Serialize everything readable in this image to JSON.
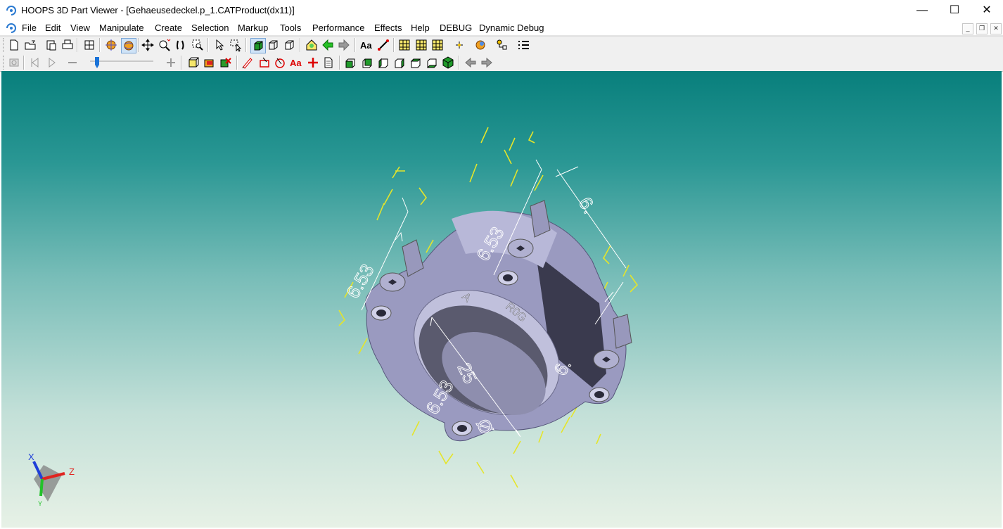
{
  "window": {
    "title": "HOOPS 3D Part Viewer - [Gehaeusedeckel.p_1.CATProduct(dx11)]",
    "controls": {
      "minimize": "—",
      "maximize": "☐",
      "close": "✕"
    }
  },
  "menu": [
    "File",
    "Edit",
    "View",
    "Manipulate",
    "Create",
    "Selection",
    "Markup",
    "Tools",
    "Performance",
    "Effects",
    "Help",
    "DEBUG",
    "Dynamic Debug"
  ],
  "mdi_controls": {
    "minimize": "_",
    "restore": "❐",
    "close": "✕"
  },
  "toolbar1_icons": [
    "new-file-icon",
    "open-file-icon",
    "paste-icon",
    "print-icon",
    "grid-icon",
    "orbit-icon",
    "turntable-icon",
    "pan-icon",
    "zoom-icon",
    "walk-icon",
    "zoom-window-icon",
    "select-icon",
    "select-area-icon",
    "shaded-icon",
    "wireframe-icon",
    "hidden-line-icon",
    "home-icon",
    "back-icon",
    "forward-icon",
    "text-icon",
    "measure-icon",
    "section-icon",
    "section2-icon",
    "section3-icon",
    "point-icon",
    "light-icon",
    "layers-icon",
    "list-icon"
  ],
  "toolbar2_icons": [
    "snapshot-icon",
    "first-frame-icon",
    "play-icon",
    "zoom-out-icon",
    "zoom-in-icon",
    "cube-front-icon",
    "cube-color-icon",
    "cube-remove-icon",
    "pen-icon",
    "rect-markup-icon",
    "circle-markup-icon",
    "text-markup-icon",
    "cross-markup-icon",
    "page-icon",
    "view-front-icon",
    "view-back-icon",
    "view-left-icon",
    "view-right-icon",
    "view-top-icon",
    "view-bottom-icon",
    "view-iso-icon",
    "prev-view-icon",
    "next-view-icon"
  ],
  "slider": {
    "value": 0.05
  },
  "model": {
    "body_color": "#9a9ac0",
    "pmi_color": "#ffffff",
    "wire_color": "#e5e52a",
    "dimensions": [
      "6.53",
      "6.53",
      "6.",
      "6.53",
      "6.",
      "25",
      "Ø"
    ],
    "engraving": [
      "A",
      "R0G"
    ]
  },
  "axis": {
    "x": "X",
    "y": "Y",
    "z": "Z",
    "x_color": "#1f3fd8",
    "y_color": "#22c22a",
    "z_color": "#e0241f"
  },
  "colors": {
    "bg_top": "#087f7c",
    "bg_bottom": "#e7f1e6"
  }
}
